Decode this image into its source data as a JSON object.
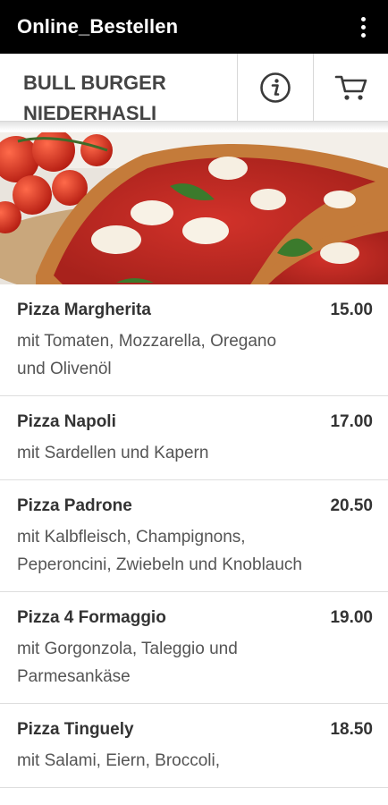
{
  "appbar": {
    "title": "Online_Bestellen",
    "menu_icon": "more-vert-icon"
  },
  "header": {
    "restaurant_name": "BULL BURGER NIEDERHASLI",
    "info_icon": "info-icon",
    "cart_icon": "cart-icon"
  },
  "hero": {
    "image": "pizza-margherita-photo"
  },
  "menu": {
    "items": [
      {
        "name": "Pizza Margherita",
        "price": "15.00",
        "description": "mit Tomaten, Mozzarella, Oregano und Olivenöl"
      },
      {
        "name": "Pizza Napoli",
        "price": "17.00",
        "description": "mit Sardellen und Kapern"
      },
      {
        "name": "Pizza Padrone",
        "price": "20.50",
        "description": "mit Kalbfleisch, Champignons, Peperoncini, Zwiebeln und Knoblauch"
      },
      {
        "name": "Pizza 4 Formaggio",
        "price": "19.00",
        "description": "mit Gorgonzola, Taleggio und Parmesankäse"
      },
      {
        "name": "Pizza Tinguely",
        "price": "18.50",
        "description": "mit Salami, Eiern, Broccoli,"
      }
    ]
  },
  "colors": {
    "appbar_bg": "#000000",
    "text": "#333333",
    "divider": "#dedede"
  }
}
